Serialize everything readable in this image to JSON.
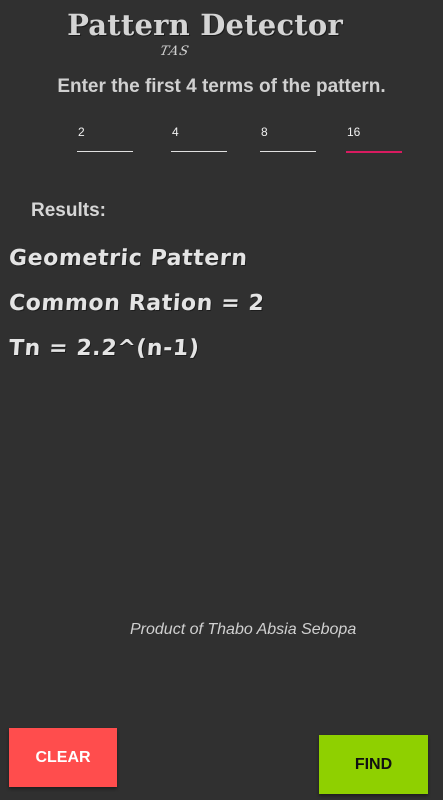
{
  "app": {
    "title": "Pattern Detector",
    "signature": "TAS"
  },
  "instruction": "Enter the first 4 terms of the pattern.",
  "terms": [
    {
      "value": "2"
    },
    {
      "value": "4"
    },
    {
      "value": "8"
    },
    {
      "value": "16"
    }
  ],
  "focused_term_color": "#d81b60",
  "results": {
    "label": "Results:",
    "pattern_type": "Geometric Pattern",
    "common_ratio": "Common Ration = 2",
    "formula": "Tn = 2.2^(n-1)"
  },
  "footer": "Product of Thabo Absia Sebopa",
  "buttons": {
    "clear_label": "CLEAR",
    "clear_color": "#ff4d4d",
    "find_label": "FIND",
    "find_color": "#8fd000"
  }
}
